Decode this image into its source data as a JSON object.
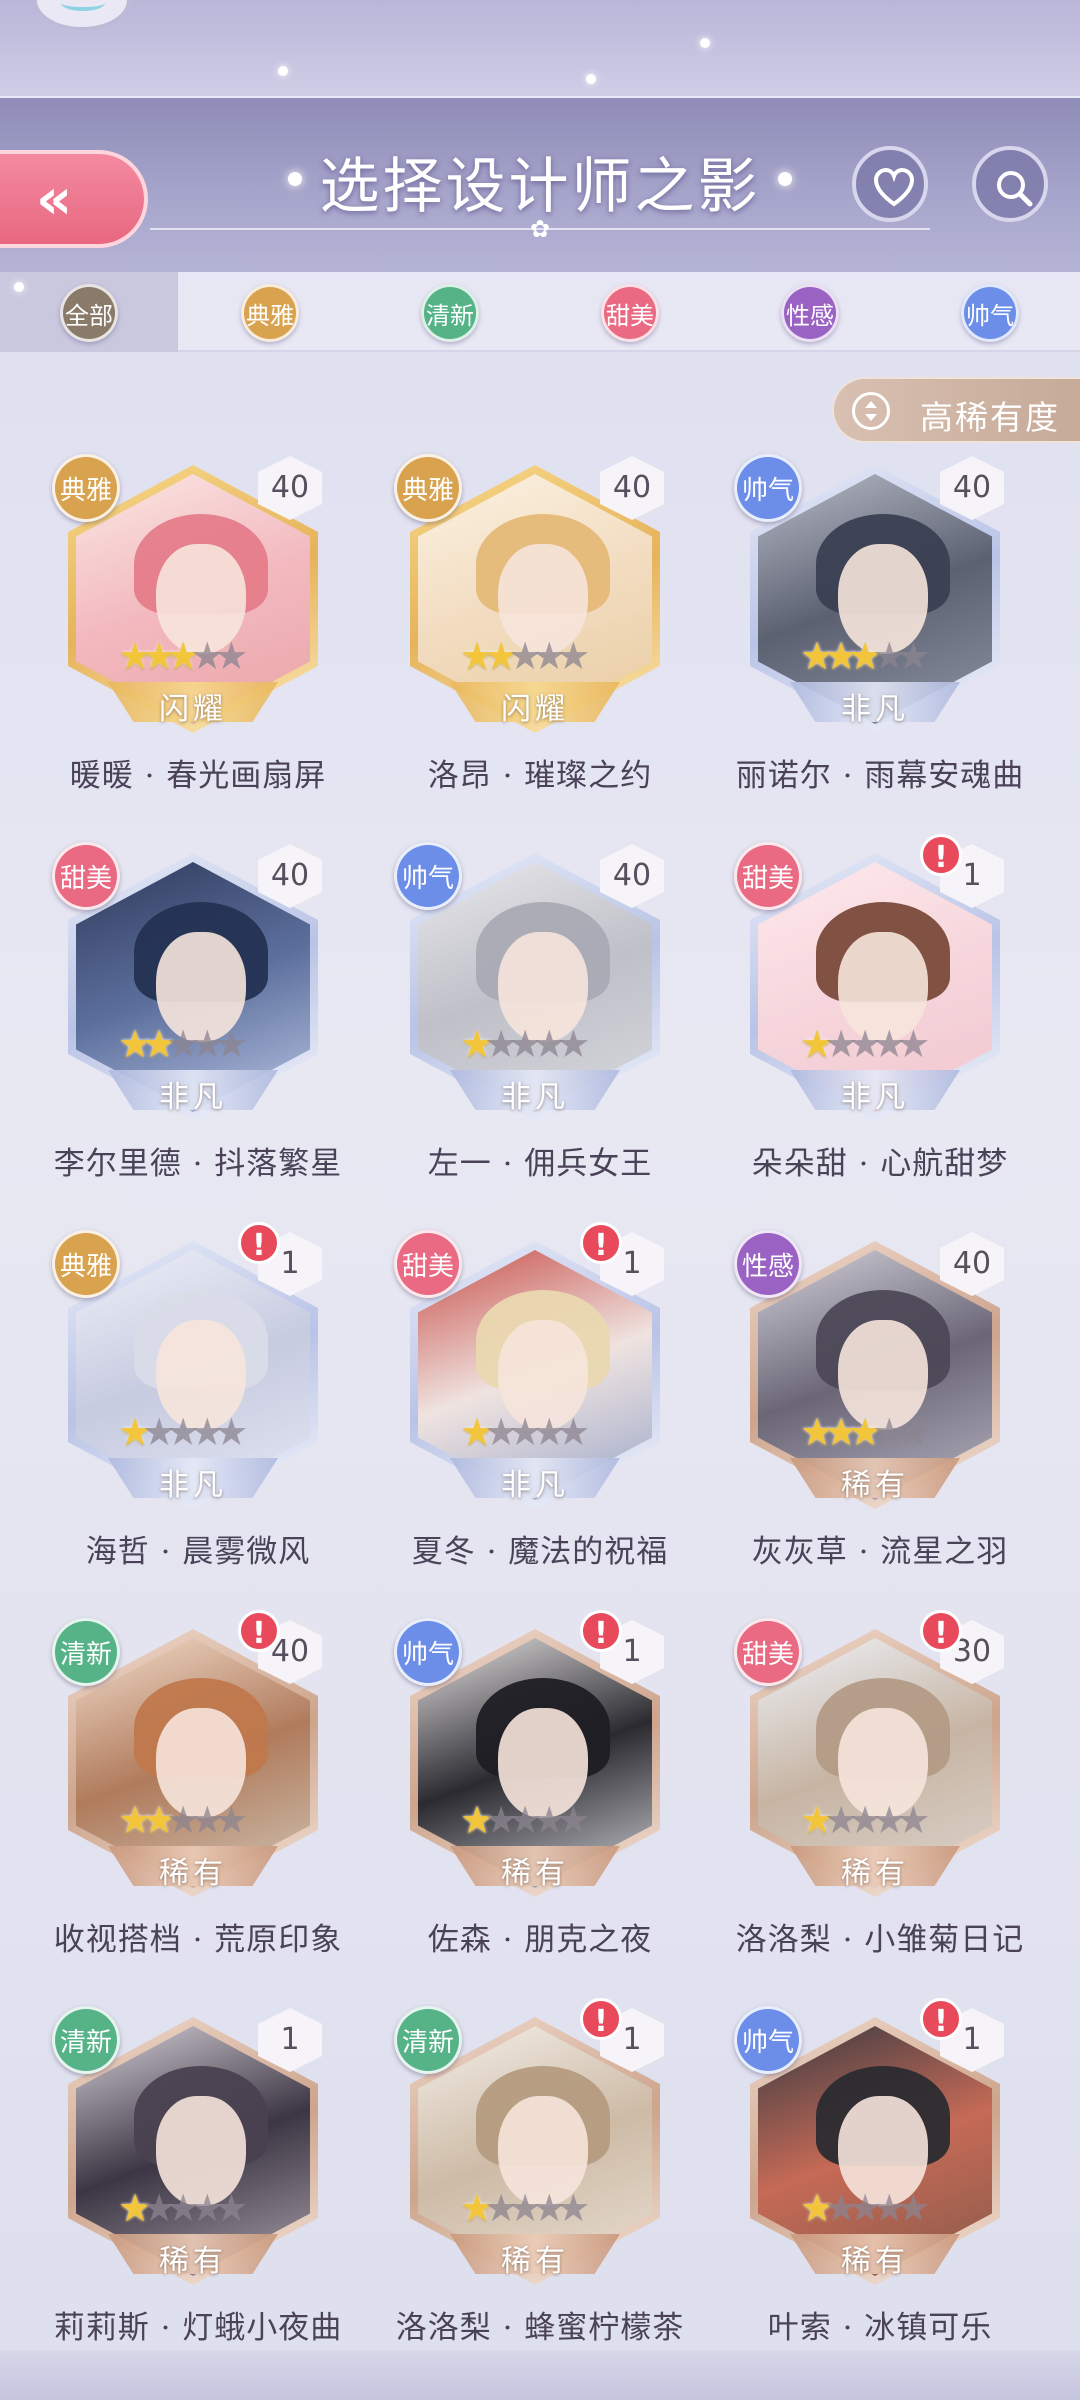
{
  "header": {
    "title": "选择设计师之影",
    "back_icon": "«",
    "heart_icon": "heart-icon",
    "search_icon": "search-icon"
  },
  "filters": [
    {
      "label": "全部",
      "color": "#8a7a6a",
      "selected": true
    },
    {
      "label": "典雅",
      "color": "#d9a24f"
    },
    {
      "label": "清新",
      "color": "#55b387"
    },
    {
      "label": "甜美",
      "color": "#ea6a83"
    },
    {
      "label": "性感",
      "color": "#9a62c2"
    },
    {
      "label": "帅气",
      "color": "#6c8ee8"
    }
  ],
  "sort": {
    "label": "高稀有度"
  },
  "rarity_labels": {
    "shine": "闪耀",
    "fei": "非凡",
    "xi": "稀有"
  },
  "cards": [
    {
      "name": "暖暖 · 春光画扇屏",
      "tag": "典雅",
      "level": "40",
      "stars": 3,
      "rarity": "闪耀",
      "alert": false
    },
    {
      "name": "洛昂 · 璀璨之约",
      "tag": "典雅",
      "level": "40",
      "stars": 2,
      "rarity": "闪耀",
      "alert": false
    },
    {
      "name": "丽诺尔 · 雨幕安魂曲",
      "tag": "帅气",
      "level": "40",
      "stars": 3,
      "rarity": "非凡",
      "alert": false
    },
    {
      "name": "李尔里德 · 抖落繁星",
      "tag": "甜美",
      "level": "40",
      "stars": 2,
      "rarity": "非凡",
      "alert": false
    },
    {
      "name": "左一 · 佣兵女王",
      "tag": "帅气",
      "level": "40",
      "stars": 1,
      "rarity": "非凡",
      "alert": false
    },
    {
      "name": "朵朵甜 · 心航甜梦",
      "tag": "甜美",
      "level": "1",
      "stars": 1,
      "rarity": "非凡",
      "alert": true
    },
    {
      "name": "海哲 · 晨雾微风",
      "tag": "典雅",
      "level": "1",
      "stars": 1,
      "rarity": "非凡",
      "alert": true
    },
    {
      "name": "夏冬 · 魔法的祝福",
      "tag": "甜美",
      "level": "1",
      "stars": 1,
      "rarity": "非凡",
      "alert": true
    },
    {
      "name": "灰灰草 · 流星之羽",
      "tag": "性感",
      "level": "40",
      "stars": 3,
      "rarity": "稀有",
      "alert": false
    },
    {
      "name": "收视搭档 · 荒原印象",
      "tag": "清新",
      "level": "40",
      "stars": 2,
      "rarity": "稀有",
      "alert": true
    },
    {
      "name": "佐森 · 朋克之夜",
      "tag": "帅气",
      "level": "1",
      "stars": 1,
      "rarity": "稀有",
      "alert": true
    },
    {
      "name": "洛洛梨 · 小雏菊日记",
      "tag": "甜美",
      "level": "30",
      "stars": 1,
      "rarity": "稀有",
      "alert": true
    },
    {
      "name": "莉莉斯 · 灯蛾小夜曲",
      "tag": "清新",
      "level": "1",
      "stars": 1,
      "rarity": "稀有",
      "alert": false
    },
    {
      "name": "洛洛梨 · 蜂蜜柠檬茶",
      "tag": "清新",
      "level": "1",
      "stars": 1,
      "rarity": "稀有",
      "alert": true
    },
    {
      "name": "叶索 · 冰镇可乐",
      "tag": "帅气",
      "level": "1",
      "stars": 1,
      "rarity": "稀有",
      "alert": true
    }
  ],
  "tag_colors": {
    "典雅": "#d9a24f",
    "清新": "#55b387",
    "甜美": "#ea6a83",
    "性感": "#9a62c2",
    "帅气": "#6c8ee8"
  }
}
